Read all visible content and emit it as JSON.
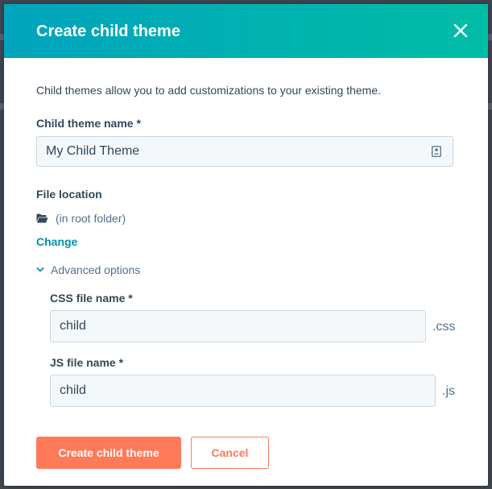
{
  "modal": {
    "title": "Create child theme",
    "intro": "Child themes allow you to add customizations to your existing theme.",
    "close_icon": "close-icon"
  },
  "form": {
    "name_label": "Child theme name *",
    "name_value": "My Child Theme",
    "name_icon": "contact-card-icon",
    "file_location_label": "File location",
    "folder_icon": "folder-open-icon",
    "folder_text": "(in root folder)",
    "change_label": "Change",
    "advanced_label": "Advanced options",
    "advanced_expanded": true,
    "css_label": "CSS file name *",
    "css_value": "child",
    "css_ext": ".css",
    "js_label": "JS file name *",
    "js_value": "child",
    "js_ext": ".js"
  },
  "actions": {
    "primary_label": "Create child theme",
    "secondary_label": "Cancel"
  },
  "colors": {
    "header_start": "#00a4bd",
    "header_end": "#00bda5",
    "link": "#0091ae",
    "primary": "#ff7a59",
    "text": "#33475b",
    "input_bg": "#f5f8fa",
    "input_border": "#cbd6e2"
  }
}
